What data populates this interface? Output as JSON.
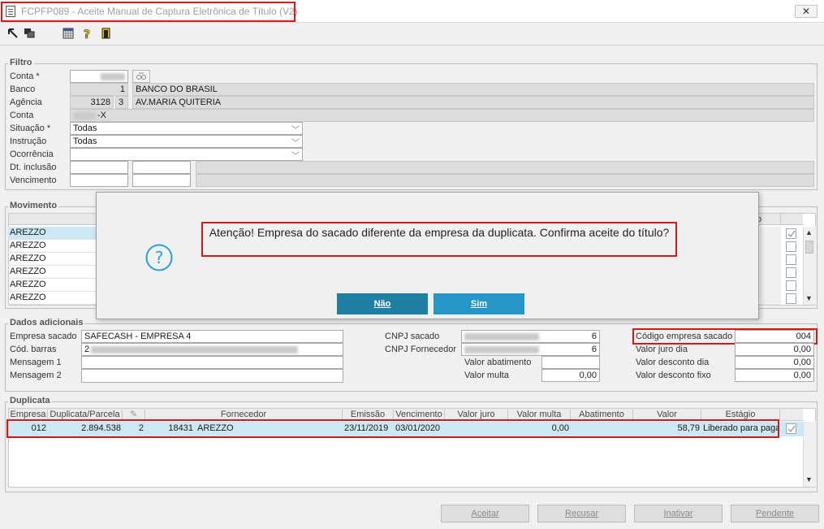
{
  "window": {
    "title": "FCPFP089 - Aceite Manual de Captura Eletrônica de Título (V2)",
    "close_symbol": "✕"
  },
  "toolbar": {
    "icons": [
      "arrow-icon",
      "windows-icon",
      "calendar-grid-icon",
      "help-icon",
      "exit-door-icon"
    ]
  },
  "filtro": {
    "legend": "Filtro",
    "labels": {
      "conta_req": "Conta *",
      "banco": "Banco",
      "agencia": "Agência",
      "conta": "Conta",
      "situacao": "Situação *",
      "instrucao": "Instrução",
      "ocorrencia": "Ocorrência",
      "dt_inclusao": "Dt. inclusão",
      "vencimento": "Vencimento"
    },
    "banco_code": "1",
    "banco_name": "BANCO DO BRASIL",
    "agencia_code": "3128",
    "agencia_digit": "3",
    "agencia_name": "AV.MARIA QUITERIA",
    "conta_suffix": "-X",
    "situacao_value": "Todas",
    "instrucao_value": "Todas",
    "ocorrencia_value": ""
  },
  "movimento": {
    "legend": "Movimento",
    "header_tail": "o",
    "rows": [
      "AREZZO",
      "AREZZO",
      "AREZZO",
      "AREZZO",
      "AREZZO",
      "AREZZO"
    ]
  },
  "dados": {
    "legend": "Dados adicionais",
    "labels": {
      "empresa_sacado": "Empresa sacado",
      "cod_barras": "Cód. barras",
      "mensagem1": "Mensagem 1",
      "mensagem2": "Mensagem 2",
      "cnpj_sacado": "CNPJ sacado",
      "cnpj_fornecedor": "CNPJ Fornecedor",
      "valor_abatimento": "Valor abatimento",
      "valor_multa": "Valor multa",
      "codigo_empresa_sacado": "Código empresa sacado",
      "valor_juro_dia": "Valor juro dia",
      "valor_desconto_dia": "Valor desconto dia",
      "valor_desconto_fixo": "Valor desconto fixo"
    },
    "empresa_sacado_value": "SAFECASH -  EMPRESA 4",
    "cod_barras_prefix": "2",
    "cnpj_sacado_suffix": "6",
    "cnpj_fornecedor_suffix": "6",
    "valor_multa_value": "0,00",
    "codigo_empresa_sacado_value": "004",
    "valor_juro_dia_value": "0,00",
    "valor_desconto_dia_value": "0,00",
    "valor_desconto_fixo_value": "0,00"
  },
  "duplicata": {
    "legend": "Duplicata",
    "headers": [
      "Empresa",
      "Duplicata/Parcela",
      "Fornecedor",
      "Emissão",
      "Vencimento",
      "Valor juro",
      "Valor multa",
      "Abatimento",
      "Valor",
      "Estágio"
    ],
    "row": {
      "empresa": "012",
      "duplicata": "2.894.538",
      "parcela": "2",
      "fornecedor_code": "18431",
      "fornecedor_name": "AREZZO",
      "emissao": "23/11/2019",
      "vencimento": "03/01/2020",
      "valor_juro": "",
      "valor_multa": "0,00",
      "abatimento": "",
      "valor": "58,79",
      "estagio": "Liberado para paga"
    }
  },
  "actions": {
    "aceitar": "Aceitar",
    "recusar": "Recusar",
    "inativar": "Inativar",
    "pendente": "Pendente"
  },
  "dialog": {
    "message": "Atenção! Empresa do sacado diferente da empresa da duplicata. Confirma aceite do título?",
    "no_label": "Não",
    "yes_label": "Sim",
    "icon": "question-icon"
  },
  "colors": {
    "highlight_red": "#d11919",
    "dialog_no": "#1f7fa3",
    "dialog_yes": "#2596c7",
    "row_selected": "#cce8f4"
  }
}
